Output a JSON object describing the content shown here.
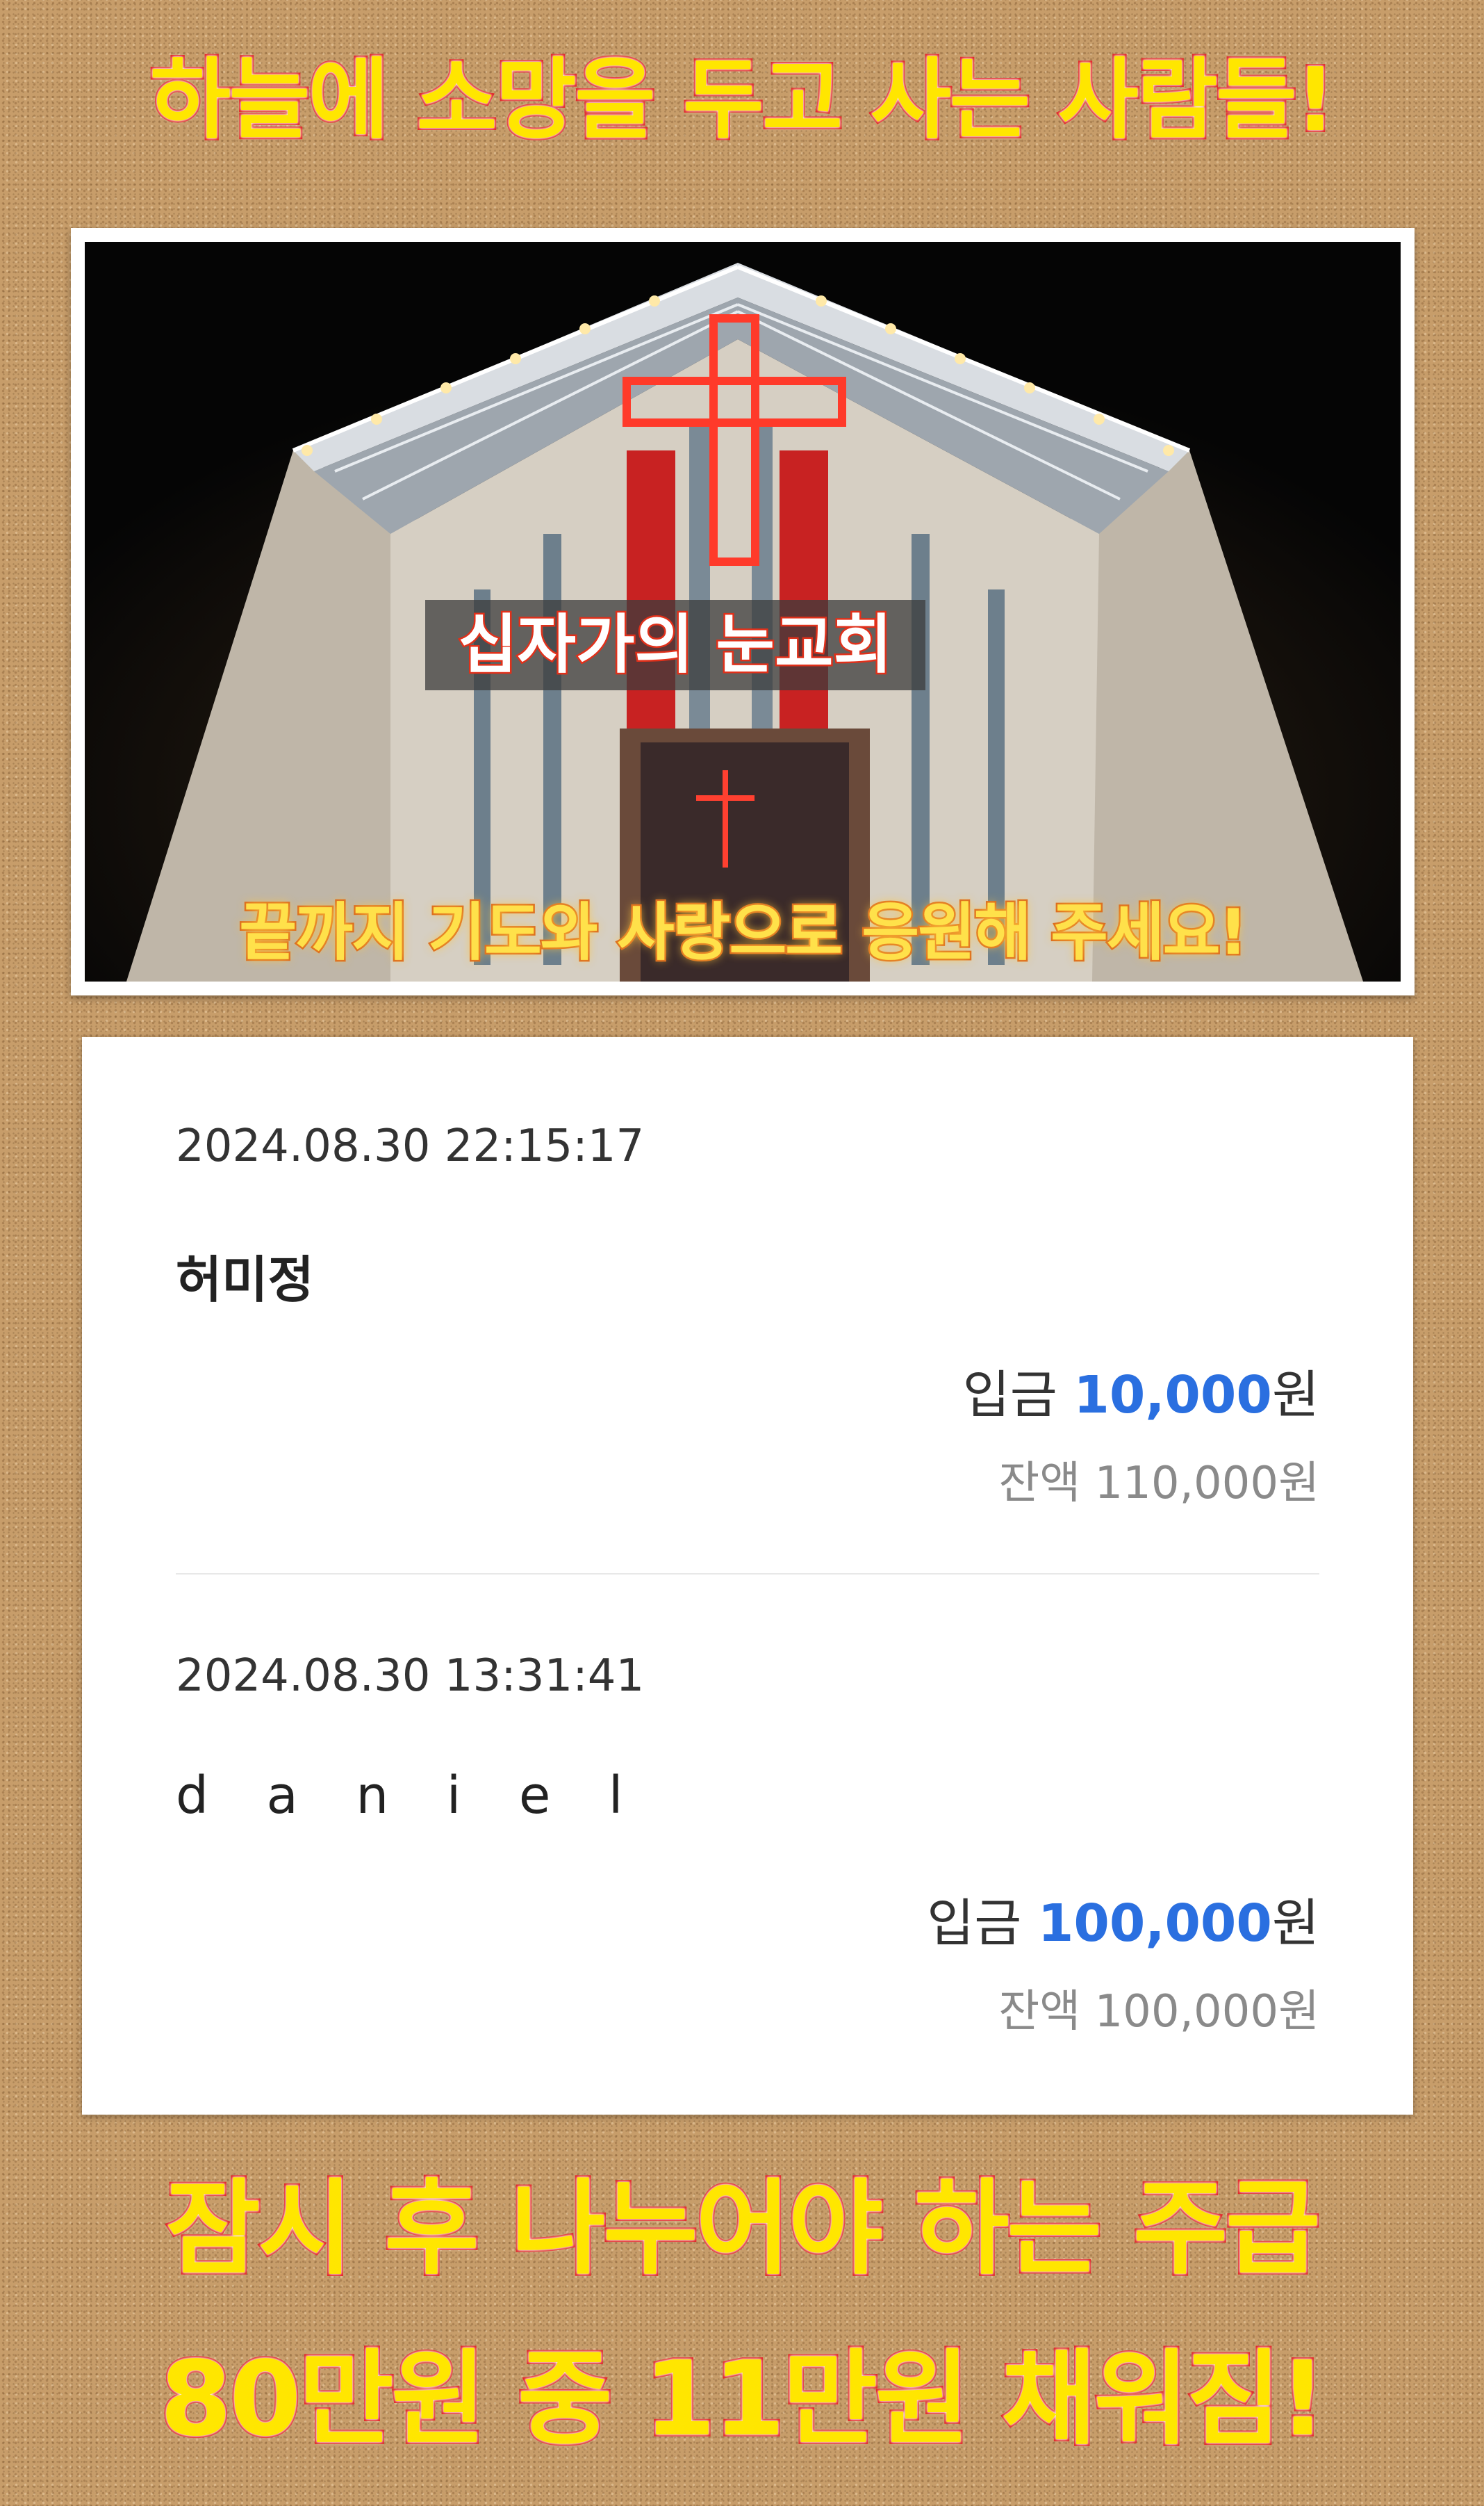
{
  "headline": {
    "top": "하늘에 소망을 두고 사는 사람들!",
    "bottom_line1": "잠시 후 나누어야 하는 주급",
    "bottom_line2": "80만원 중 11만원 채워짐!"
  },
  "photo": {
    "label": "십자가의 눈교회",
    "caption": "끝까지 기도와 사랑으로 응원해 주세요!"
  },
  "transactions": [
    {
      "datetime": "2024.08.30 22:15:17",
      "name": "허미정",
      "deposit_label": "입금",
      "amount": "10,000",
      "currency": "원",
      "balance_label": "잔액",
      "balance": "110,000",
      "balance_currency": "원"
    },
    {
      "datetime": "2024.08.30 13:31:41",
      "name": "d a n i e l",
      "deposit_label": "입금",
      "amount": "100,000",
      "currency": "원",
      "balance_label": "잔액",
      "balance": "100,000",
      "balance_currency": "원"
    }
  ],
  "colors": {
    "headline_fill": "#ffe600",
    "headline_stroke": "#e02020",
    "amount_accent": "#2a6fe0",
    "balance_text": "#8a8a8a"
  }
}
